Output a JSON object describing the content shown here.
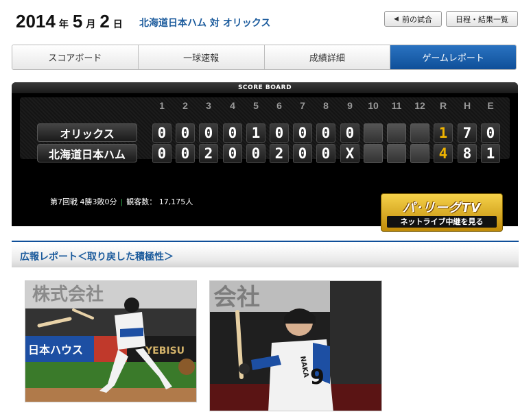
{
  "header": {
    "year": "2014",
    "year_unit": "年",
    "month": "5",
    "month_unit": "月",
    "day": "2",
    "day_unit": "日",
    "matchup": "北海道日本ハム 対 オリックス",
    "prev_game": "前の試合",
    "schedule": "日程・結果一覧"
  },
  "tabs": [
    {
      "label": "スコアボード",
      "active": false
    },
    {
      "label": "一球速報",
      "active": false
    },
    {
      "label": "成績詳細",
      "active": false
    },
    {
      "label": "ゲームレポート",
      "active": true
    }
  ],
  "scoreboard": {
    "title": "SCORE BOARD",
    "columns": [
      "1",
      "2",
      "3",
      "4",
      "5",
      "6",
      "7",
      "8",
      "9",
      "10",
      "11",
      "12",
      "R",
      "H",
      "E"
    ],
    "teams": [
      {
        "name": "オリックス",
        "innings": [
          "0",
          "0",
          "0",
          "0",
          "1",
          "0",
          "0",
          "0",
          "0",
          "",
          "",
          ""
        ],
        "R": "1",
        "H": "7",
        "E": "0"
      },
      {
        "name": "北海道日本ハム",
        "innings": [
          "0",
          "0",
          "2",
          "0",
          "0",
          "2",
          "0",
          "0",
          "X",
          "",
          "",
          ""
        ],
        "R": "4",
        "H": "8",
        "E": "1"
      }
    ],
    "info": {
      "game_no": "第7回戦 4勝3敗0分",
      "attendance_label": "観客数：",
      "attendance": "17,175人"
    },
    "pacific_tv": {
      "logo": "パ･リーグTV",
      "button": "ネットライブ中継を見る"
    }
  },
  "report": {
    "title": "広報レポート＜取り戻した積極性＞"
  },
  "photo2": {
    "jersey_name": "NAKA",
    "jersey_number": "9"
  },
  "colors": {
    "accent_blue": "#0f4f99",
    "runs_gold": "#f0b400",
    "scoreboard_bg": "#000000"
  },
  "icons": {
    "prev_arrow": "triangle-left-icon"
  }
}
